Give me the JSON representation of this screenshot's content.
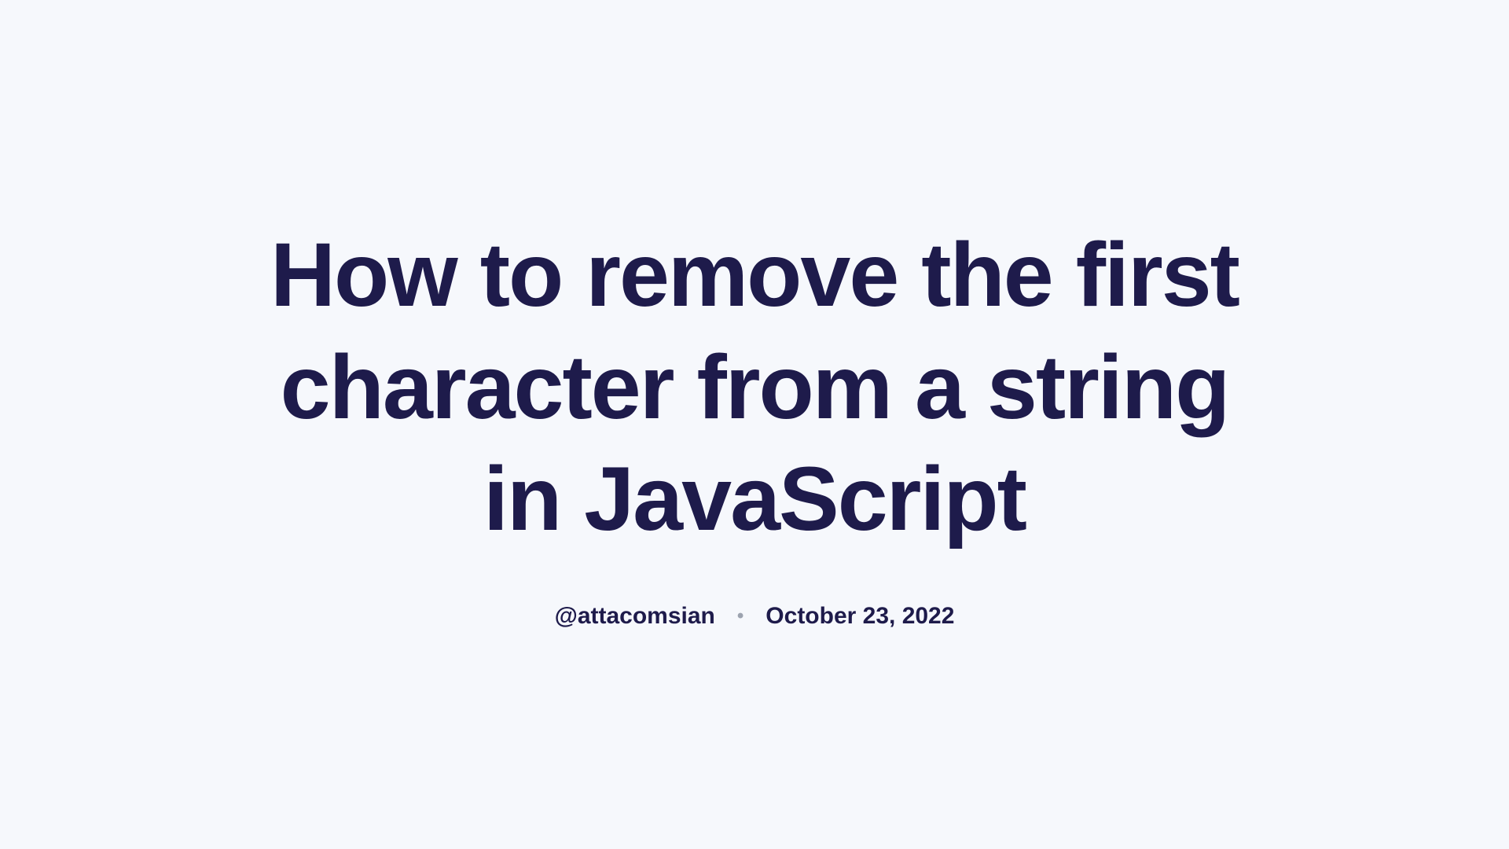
{
  "article": {
    "title": "How to remove the first character from a string in JavaScript",
    "author": "@attacomsian",
    "separator": "•",
    "date": "October 23, 2022"
  }
}
